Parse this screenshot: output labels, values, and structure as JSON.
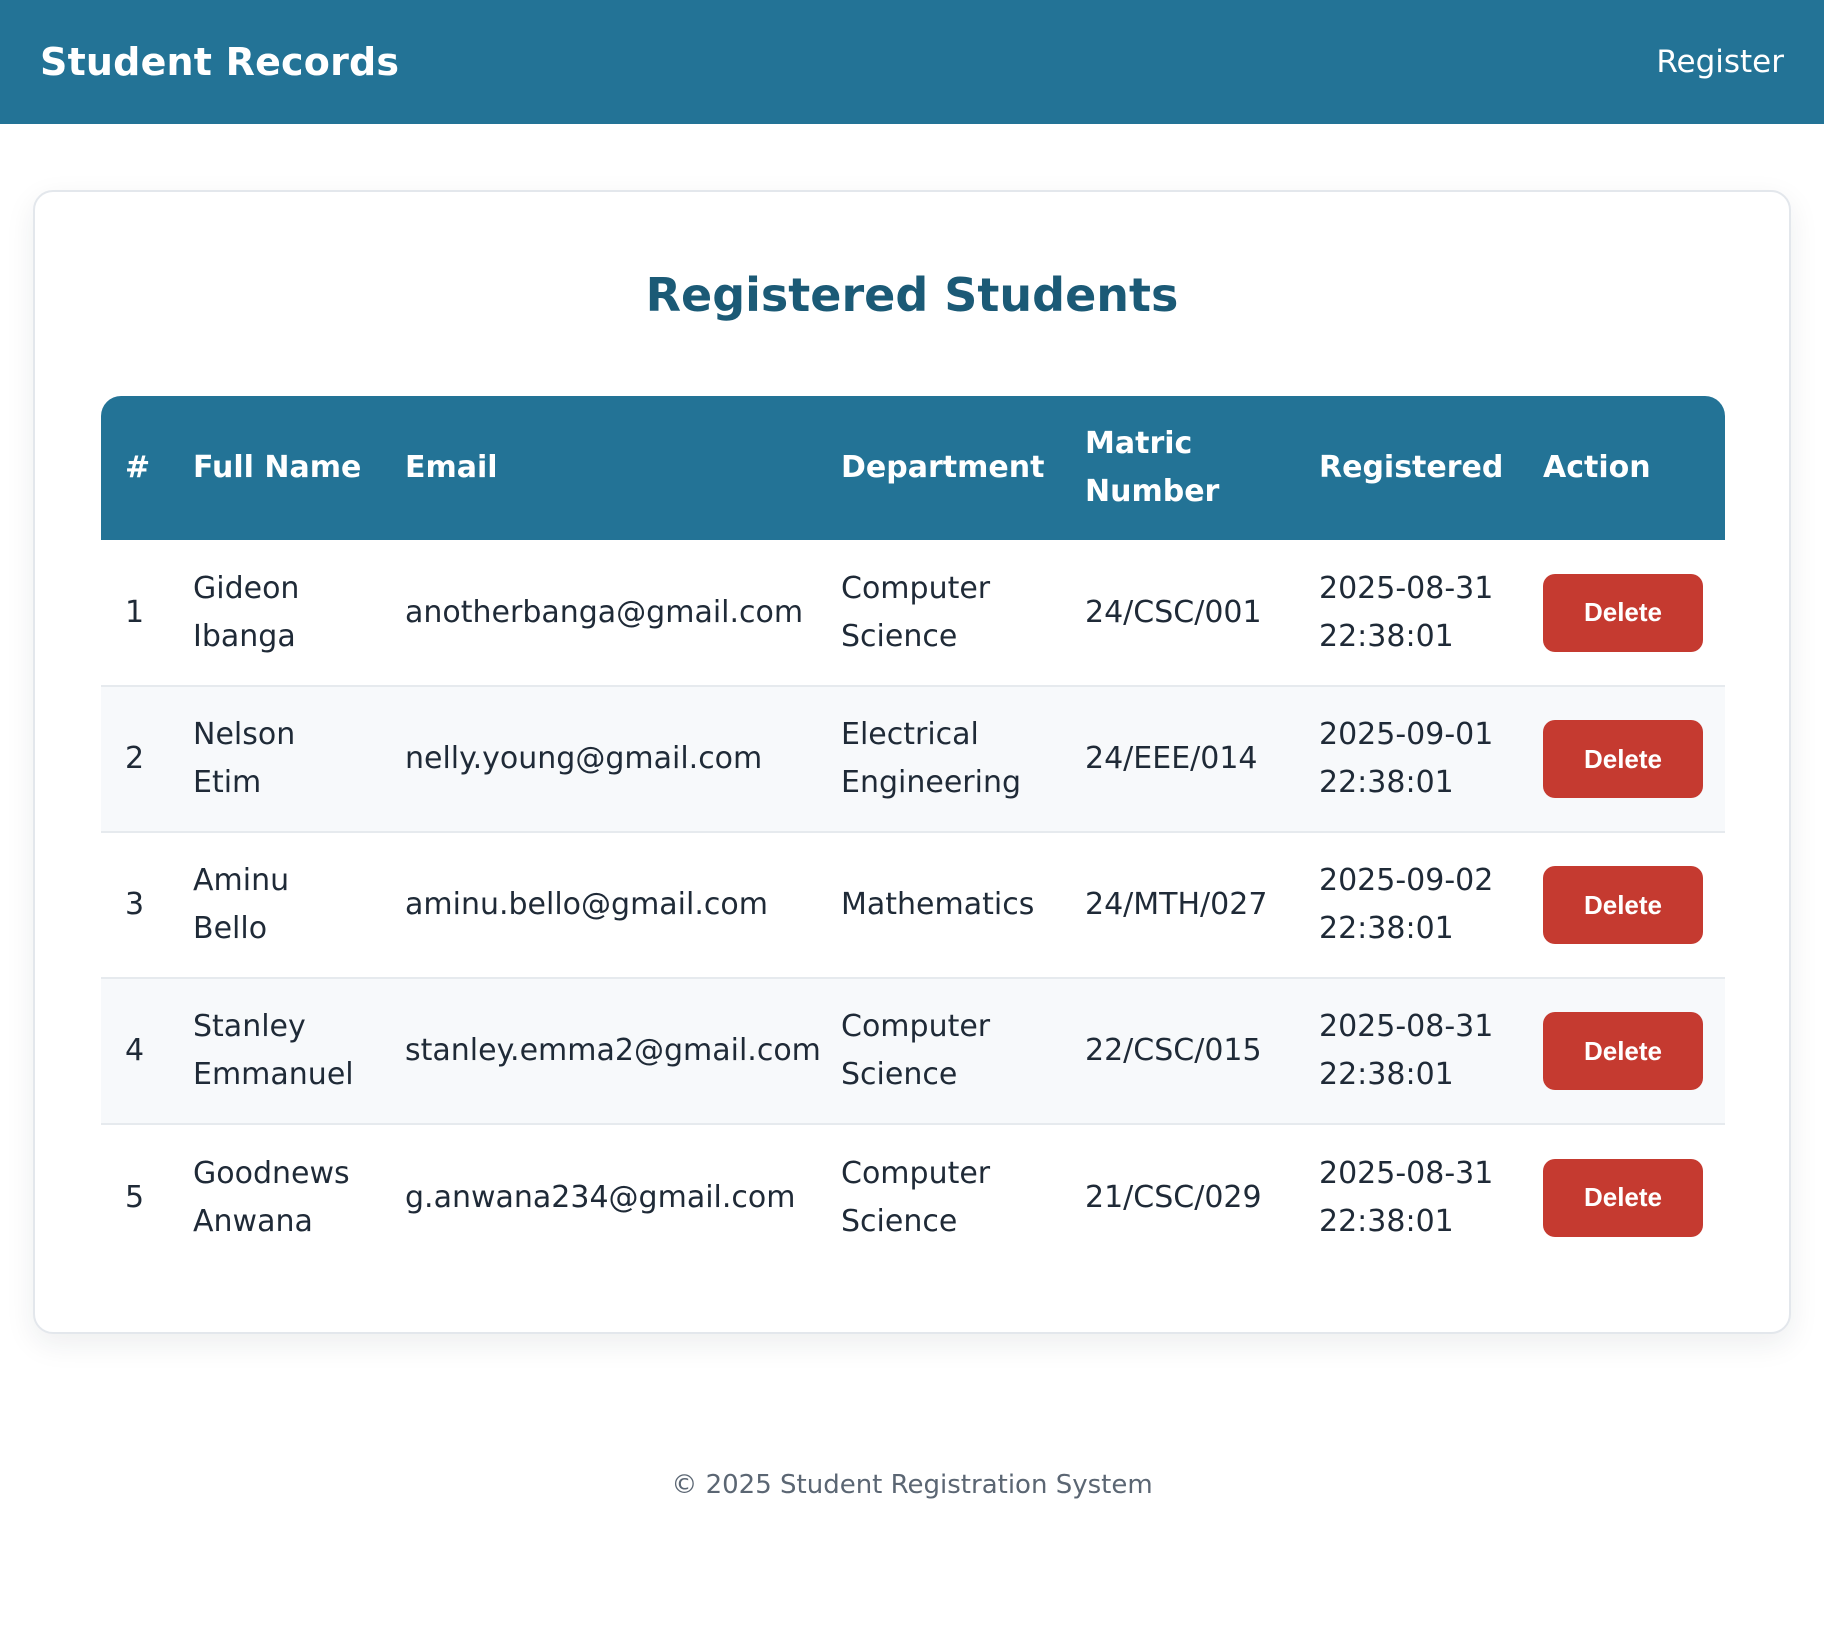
{
  "header": {
    "brand": "Student Records",
    "nav_register": "Register"
  },
  "main": {
    "title": "Registered Students",
    "columns": {
      "index": "#",
      "full_name": "Full Name",
      "email": "Email",
      "department": "Department",
      "matric_line1": "Matric",
      "matric_line2": "Number",
      "registered": "Registered",
      "action": "Action"
    },
    "rows": [
      {
        "index": "1",
        "name_first": "Gideon",
        "name_last": "Ibanga",
        "email": "anotherbanga@gmail.com",
        "dept_line1": "Computer",
        "dept_line2": "Science",
        "matric": "24/CSC/001",
        "date": "2025-08-31",
        "time": "22:38:01",
        "action_label": "Delete"
      },
      {
        "index": "2",
        "name_first": "Nelson",
        "name_last": "Etim",
        "email": "nelly.young@gmail.com",
        "dept_line1": "Electrical",
        "dept_line2": "Engineering",
        "matric": "24/EEE/014",
        "date": "2025-09-01",
        "time": "22:38:01",
        "action_label": "Delete"
      },
      {
        "index": "3",
        "name_first": "Aminu",
        "name_last": "Bello",
        "email": "aminu.bello@gmail.com",
        "dept_line1": "Mathematics",
        "dept_line2": "",
        "matric": "24/MTH/027",
        "date": "2025-09-02",
        "time": "22:38:01",
        "action_label": "Delete"
      },
      {
        "index": "4",
        "name_first": "Stanley",
        "name_last": "Emmanuel",
        "email": "stanley.emma2@gmail.com",
        "dept_line1": "Computer",
        "dept_line2": "Science",
        "matric": "22/CSC/015",
        "date": "2025-08-31",
        "time": "22:38:01",
        "action_label": "Delete"
      },
      {
        "index": "5",
        "name_first": "Goodnews",
        "name_last": "Anwana",
        "email": "g.anwana234@gmail.com",
        "dept_line1": "Computer",
        "dept_line2": "Science",
        "matric": "21/CSC/029",
        "date": "2025-08-31",
        "time": "22:38:01",
        "action_label": "Delete"
      }
    ]
  },
  "footer": {
    "text": "© 2025 Student Registration System"
  },
  "colors": {
    "primary": "#237396",
    "title": "#1b5a76",
    "danger": "#c53a30"
  }
}
